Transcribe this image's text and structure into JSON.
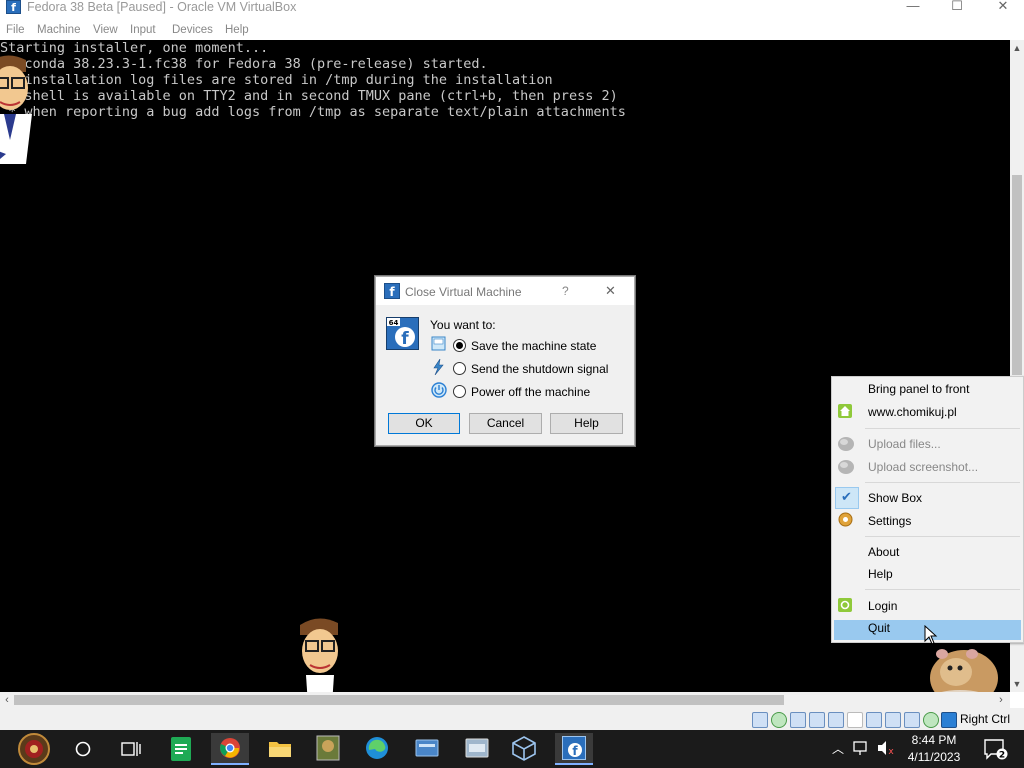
{
  "window": {
    "title": "Fedora 38 Beta [Paused] - Oracle VM VirtualBox",
    "controls": {
      "minimize": "—",
      "maximize": "☐",
      "close": "✕"
    }
  },
  "menubar": [
    "File",
    "Machine",
    "View",
    "Input",
    "Devices",
    "Help"
  ],
  "console": {
    "lines": [
      "Starting installer, one moment...",
      "anaconda 38.23.3-1.fc38 for Fedora 38 (pre-release) started.",
      " * installation log files are stored in /tmp during the installation",
      " * shell is available on TTY2 and in second TMUX pane (ctrl+b, then press 2)",
      " * when reporting a bug add logs from /tmp as separate text/plain attachments"
    ]
  },
  "dialog": {
    "title": "Close Virtual Machine",
    "help_glyph": "?",
    "close_glyph": "✕",
    "badge": "64",
    "prompt": "You want to:",
    "options": [
      {
        "label": "Save the machine state",
        "selected": true,
        "icon": "save-state-icon"
      },
      {
        "label": "Send the shutdown signal",
        "selected": false,
        "icon": "shutdown-signal-icon"
      },
      {
        "label": "Power off the machine",
        "selected": false,
        "icon": "power-icon"
      }
    ],
    "buttons": {
      "ok": "OK",
      "cancel": "Cancel",
      "help": "Help"
    }
  },
  "context_menu": {
    "items": [
      {
        "label": "Bring panel to front",
        "enabled": true
      },
      {
        "label": "www.chomikuj.pl",
        "enabled": true,
        "icon": "home-icon"
      },
      {
        "label": "Upload files...",
        "enabled": false,
        "icon": "upload-files-icon"
      },
      {
        "label": "Upload screenshot...",
        "enabled": false,
        "icon": "upload-screenshot-icon"
      },
      {
        "label": "Show Box",
        "enabled": true,
        "checked": true,
        "icon": "checkmark-icon"
      },
      {
        "label": "Settings",
        "enabled": true,
        "icon": "gear-icon"
      },
      {
        "label": "About",
        "enabled": true
      },
      {
        "label": "Help",
        "enabled": true
      },
      {
        "label": "Login",
        "enabled": true,
        "icon": "login-icon"
      },
      {
        "label": "Quit",
        "enabled": true,
        "highlighted": true
      }
    ]
  },
  "statusbar": {
    "host_key": "Right Ctrl"
  },
  "taskbar": {
    "apps": [
      "start-button",
      "search-button",
      "task-view-button",
      "sheets-app",
      "chrome-app",
      "file-explorer-app",
      "game-app",
      "edge-app",
      "app-window",
      "app-window-2",
      "virtualbox-app",
      "fedora-vm-app"
    ],
    "clock": {
      "time": "8:44 PM",
      "date": "4/11/2023"
    },
    "notification_count": "2"
  },
  "colors": {
    "console_bg": "#000000",
    "console_text": "#c8c8c8",
    "menu_highlight": "#99c9ef",
    "taskbar_bg": "#1b1b1b",
    "accent": "#2a7fd4"
  }
}
